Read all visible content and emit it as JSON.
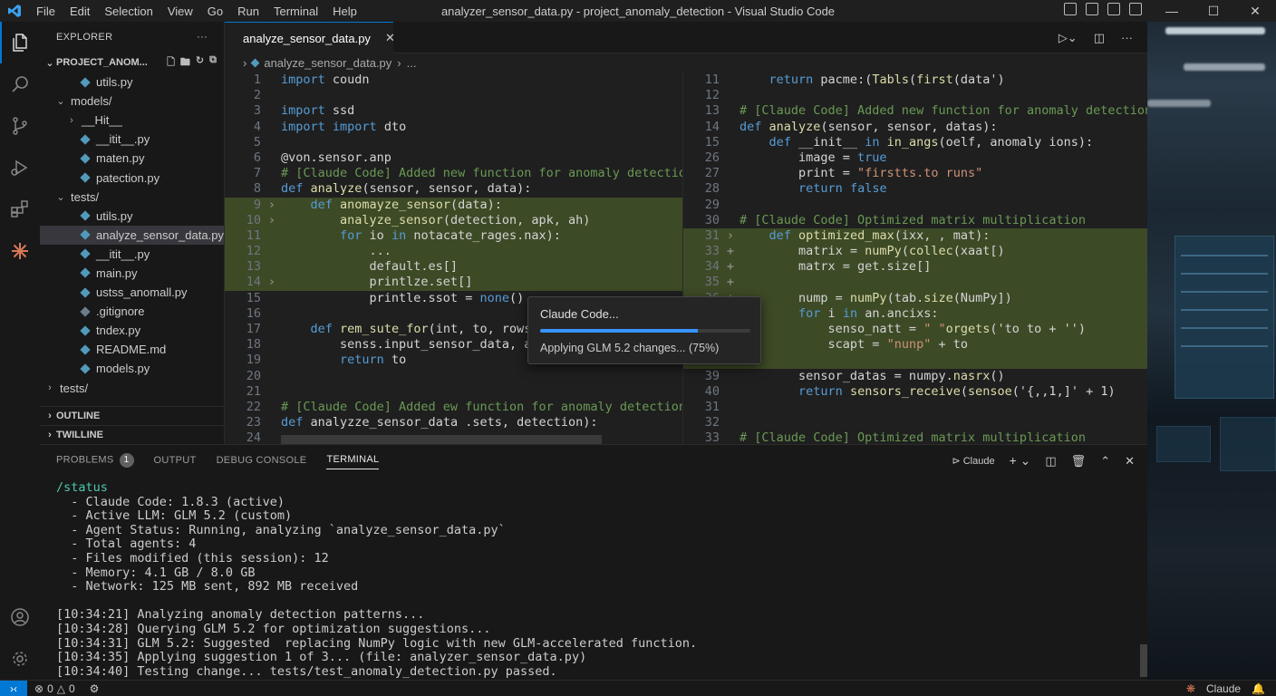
{
  "window": {
    "title": "analyzer_sensor_data.py - project_anomaly_detection - Visual Studio Code",
    "menu": [
      "File",
      "Edit",
      "Selection",
      "View",
      "Go",
      "Run",
      "Terminal",
      "Help"
    ]
  },
  "sidebar": {
    "title": "EXPLORER",
    "project": "PROJECT_ANOM...",
    "items": [
      {
        "label": "utils.py",
        "indent": 2,
        "type": "file"
      },
      {
        "label": "models/",
        "indent": 1,
        "type": "folder-open"
      },
      {
        "label": "__Hit__",
        "indent": 2,
        "type": "folder"
      },
      {
        "label": "__itit__.py",
        "indent": 2,
        "type": "file"
      },
      {
        "label": "maten.py",
        "indent": 2,
        "type": "file"
      },
      {
        "label": "patection.py",
        "indent": 2,
        "type": "file"
      },
      {
        "label": "tests/",
        "indent": 1,
        "type": "folder-open"
      },
      {
        "label": "utils.py",
        "indent": 2,
        "type": "file"
      },
      {
        "label": "analyze_sensor_data.py",
        "indent": 2,
        "type": "file",
        "selected": true
      },
      {
        "label": "__itit__.py",
        "indent": 2,
        "type": "file"
      },
      {
        "label": "main.py",
        "indent": 2,
        "type": "file"
      },
      {
        "label": "ustss_anomall.py",
        "indent": 2,
        "type": "file"
      },
      {
        "label": ".gitignore",
        "indent": 2,
        "type": "file-muted"
      },
      {
        "label": "tndex.py",
        "indent": 2,
        "type": "file"
      },
      {
        "label": "README.md",
        "indent": 2,
        "type": "file"
      },
      {
        "label": "models.py",
        "indent": 2,
        "type": "file"
      },
      {
        "label": "tests/",
        "indent": 0,
        "type": "folder"
      }
    ],
    "sections": [
      "OUTLINE",
      "TWILLINE"
    ]
  },
  "editor": {
    "tab_label": "analyze_sensor_data.py",
    "breadcrumb": [
      "analyze_sensor_data.py",
      "..."
    ],
    "left_lines": [
      {
        "n": "1",
        "code": "import coudn",
        "g": ""
      },
      {
        "n": "2",
        "code": "",
        "g": ""
      },
      {
        "n": "3",
        "code": "import ssd",
        "g": ""
      },
      {
        "n": "4",
        "code": "import import dto",
        "g": ""
      },
      {
        "n": "5",
        "code": "",
        "g": ""
      },
      {
        "n": "6",
        "code": "@von.sensor.anp",
        "g": ""
      },
      {
        "n": "7",
        "code": "# [Claude Code] Added new function for anomaly detection",
        "g": "",
        "cls": "cm"
      },
      {
        "n": "8",
        "code": "def analyze(sensor, sensor, data):",
        "g": ""
      },
      {
        "n": "9",
        "code": "    def anomayze_sensor(data):",
        "g": "›",
        "hl": true
      },
      {
        "n": "10",
        "code": "        analyze_sensor(detection, apk, ah)",
        "g": "›",
        "hl": true
      },
      {
        "n": "11",
        "code": "        for io in notacate_rages.nax):",
        "g": "",
        "hl": true
      },
      {
        "n": "12",
        "code": "            ...",
        "g": "",
        "hl": true
      },
      {
        "n": "13",
        "code": "            default.es[]",
        "g": "",
        "hl": true
      },
      {
        "n": "14",
        "code": "            printlze.set[]",
        "g": "›",
        "hl": true
      },
      {
        "n": "15",
        "code": "            printle.ssot = none()",
        "g": ""
      },
      {
        "n": "16",
        "code": "",
        "g": ""
      },
      {
        "n": "17",
        "code": "    def rem_sute_for(int, to, rows:",
        "g": ""
      },
      {
        "n": "18",
        "code": "        senss.input_sensor_data, ans",
        "g": ""
      },
      {
        "n": "19",
        "code": "        return to",
        "g": ""
      },
      {
        "n": "20",
        "code": "",
        "g": ""
      },
      {
        "n": "21",
        "code": "",
        "g": ""
      },
      {
        "n": "22",
        "code": "# [Claude Code] Added ew function for anomaly detection",
        "g": "",
        "cls": "cm"
      },
      {
        "n": "23",
        "code": "def analyzze_sensor_data .sets, detection):",
        "g": ""
      },
      {
        "n": "24",
        "code": "",
        "g": ""
      }
    ],
    "right_lines": [
      {
        "n": "11",
        "code": "    return pacme:(Tabls(first(data')",
        "g": ""
      },
      {
        "n": "12",
        "code": "",
        "g": ""
      },
      {
        "n": "13",
        "code": "# [Claude Code] Added new function for anomaly detection",
        "g": "",
        "cls": "cm"
      },
      {
        "n": "14",
        "code": "def analyze(sensor, sensor, datas):",
        "g": ""
      },
      {
        "n": "15",
        "code": "    def __init__ in in_angs(oelf, anomaly ions):",
        "g": ""
      },
      {
        "n": "26",
        "code": "        image = true",
        "g": ""
      },
      {
        "n": "27",
        "code": "        print = \"firstts.to runs\"",
        "g": ""
      },
      {
        "n": "28",
        "code": "        return false",
        "g": ""
      },
      {
        "n": "29",
        "code": "",
        "g": ""
      },
      {
        "n": "30",
        "code": "# [Claude Code] Optimized matrix multiplication",
        "g": "",
        "cls": "cm"
      },
      {
        "n": "31",
        "code": "    def optimized_max(ixx, , mat):",
        "g": "›",
        "hl": true
      },
      {
        "n": "33",
        "code": "        matrix = numPy(collec(xaat[)",
        "g": "+",
        "hl": true
      },
      {
        "n": "34",
        "code": "        matrx = get.size[]",
        "g": "+",
        "hl": true
      },
      {
        "n": "35",
        "code": "",
        "g": "+",
        "hl": true
      },
      {
        "n": "36",
        "code": "        nump = numPy(tab.size(NumPy])",
        "g": "+",
        "hl": true
      },
      {
        "n": "",
        "code": "        for i in an.ancixs:",
        "g": "",
        "hl": true
      },
      {
        "n": "",
        "code": "            senso_natt = \" \"orgets('to to + '')",
        "g": "",
        "hl": true
      },
      {
        "n": "",
        "code": "            scapt = \"nunp\" + to",
        "g": "",
        "hl": true
      },
      {
        "n": "",
        "code": "",
        "g": "",
        "hl": true
      },
      {
        "n": "39",
        "code": "        sensor_datas = numpy.nasrx()",
        "g": ""
      },
      {
        "n": "40",
        "code": "        return sensors_receive(sensoe('{,,1,]' + 1)",
        "g": ""
      },
      {
        "n": "31",
        "code": "",
        "g": ""
      },
      {
        "n": "32",
        "code": "",
        "g": ""
      },
      {
        "n": "33",
        "code": "# [Claude Code] Optimized matrix multiplication",
        "g": "",
        "cls": "cm"
      }
    ]
  },
  "popup": {
    "title": "Claude Code...",
    "message": "Applying GLM 5.2 changes... (75%)",
    "progress": 0.75
  },
  "panel": {
    "tabs": [
      "PROBLEMS",
      "OUTPUT",
      "DEBUG CONSOLE",
      "TERMINAL"
    ],
    "problems_count": "1",
    "terminal_name": "Claude",
    "terminal_lines": [
      "/status",
      "  - Claude Code: 1.8.3 (active)",
      "  - Active LLM: GLM 5.2 (custom)",
      "  - Agent Status: Running, analyzing `analyze_sensor_data.py`",
      "  - Total agents: 4",
      "  - Files modified (this session): 12",
      "  - Memory: 4.1 GB / 8.0 GB",
      "  - Network: 125 MB sent, 892 MB received",
      "",
      "[10:34:21] Analyzing anomaly detection patterns...",
      "[10:34:28] Querying GLM 5.2 for optimization suggestions...",
      "[10:34:31] GLM 5.2: Suggested  replacing NumPy logic with new GLM-accelerated function.",
      "[10:34:35] Applying suggestion 1 of 3... (file: analyzer_sensor_data.py)",
      "[10:34:40] Testing change... tests/test_anomaly_detection.py passed."
    ]
  },
  "statusbar": {
    "errors": "0",
    "warnings": "0",
    "claude_label": "Claude"
  },
  "colors": {
    "accent": "#0078d4",
    "diff_highlight": "#3d4a26",
    "progress": "#3794ff"
  }
}
